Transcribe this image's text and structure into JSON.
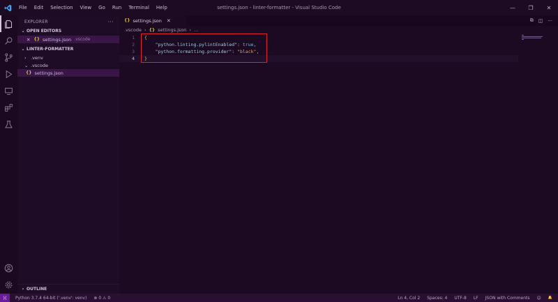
{
  "window": {
    "title": "settings.json - linter-formatter - Visual Studio Code",
    "controls": [
      "—",
      "❐",
      "✕"
    ]
  },
  "menu": [
    "File",
    "Edit",
    "Selection",
    "View",
    "Go",
    "Run",
    "Terminal",
    "Help"
  ],
  "activity_bar": {
    "items": [
      "explorer-icon",
      "search-icon",
      "source-control-icon",
      "run-debug-icon",
      "remote-explorer-icon",
      "extensions-icon",
      "testing-icon"
    ],
    "bottom": [
      "account-icon",
      "settings-gear-icon"
    ]
  },
  "sidebar": {
    "title": "EXPLORER",
    "more": "···",
    "open_editors": {
      "label": "OPEN EDITORS",
      "items": [
        {
          "close": "✕",
          "icon": "{}",
          "name": "settings.json",
          "dir": ".vscode"
        }
      ]
    },
    "folder": {
      "label": "LINTER-FORMATTER",
      "items": [
        {
          "chev": "›",
          "name": ".venv"
        },
        {
          "chev": "⌄",
          "name": ".vscode"
        },
        {
          "icon": "{}",
          "name": "settings.json"
        }
      ]
    },
    "outline": {
      "chev": "›",
      "label": "OUTLINE"
    }
  },
  "editor": {
    "tab": {
      "icon": "{}",
      "label": "settings.json",
      "close": "✕"
    },
    "actions": [
      "⧉",
      "◫",
      "···"
    ],
    "breadcrumb": [
      ".vscode",
      "settings.json",
      "..."
    ],
    "breadcrumb_sep": "›",
    "breadcrumb_icon": "{}",
    "lines": [
      {
        "n": "1",
        "parts": [
          {
            "c": "b",
            "t": "{"
          }
        ]
      },
      {
        "n": "2",
        "parts": [
          {
            "c": "p",
            "t": "    "
          },
          {
            "c": "k",
            "t": "\"python.linting.pylintEnabled\""
          },
          {
            "c": "p",
            "t": ": "
          },
          {
            "c": "v",
            "t": "true"
          },
          {
            "c": "p",
            "t": ","
          }
        ]
      },
      {
        "n": "3",
        "parts": [
          {
            "c": "p",
            "t": "    "
          },
          {
            "c": "k",
            "t": "\"python.formatting.provider\""
          },
          {
            "c": "p",
            "t": ": "
          },
          {
            "c": "s",
            "t": "\"black\""
          },
          {
            "c": "p",
            "t": ","
          }
        ]
      },
      {
        "n": "4",
        "parts": [
          {
            "c": "b",
            "t": "}"
          }
        ]
      }
    ],
    "current_line": 4
  },
  "statusbar": {
    "remote": "⟩⟨",
    "interpreter": "Python 3.7.4 64-bit ('.venv': venv)",
    "problems": "⊗ 0 ⚠ 0",
    "position": "Ln 4, Col 2",
    "spaces": "Spaces: 4",
    "encoding": "UTF-8",
    "eol": "LF",
    "language": "JSON with Comments",
    "feedback": "☺",
    "bell": "🔔"
  },
  "colors": {
    "background": "#1b0a22",
    "sidebar": "#1e0b26",
    "statusbar": "#2a0f33",
    "highlight_box": "#e2222e",
    "string": "#d7a27b",
    "key": "#9ccfe8"
  }
}
